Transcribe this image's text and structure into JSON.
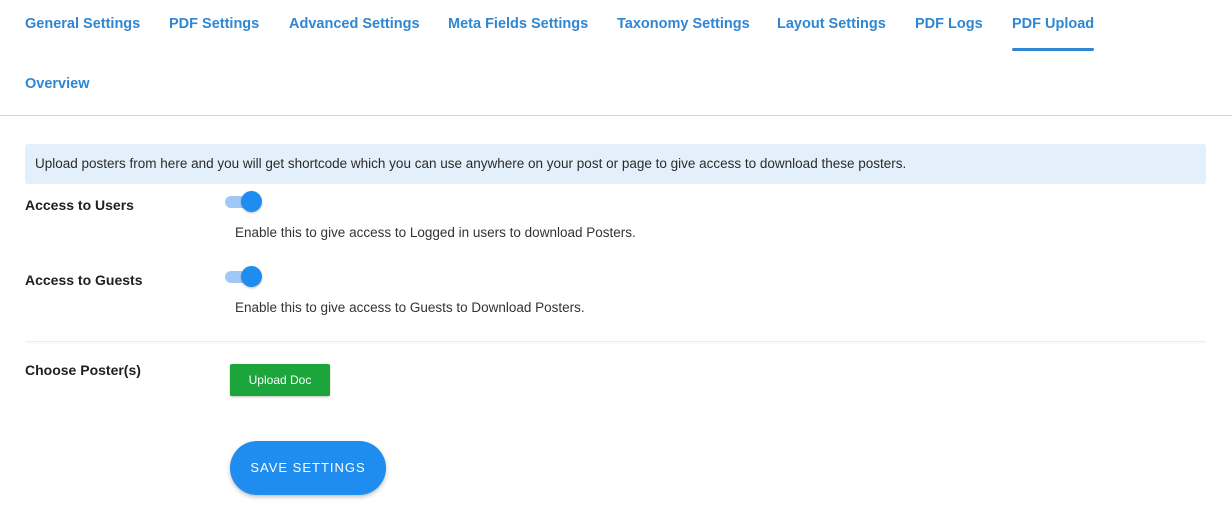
{
  "tabs": [
    {
      "label": "General Settings",
      "active": false
    },
    {
      "label": "PDF Settings",
      "active": false
    },
    {
      "label": "Advanced Settings",
      "active": false
    },
    {
      "label": "Meta Fields Settings",
      "active": false
    },
    {
      "label": "Taxonomy Settings",
      "active": false
    },
    {
      "label": "Layout Settings",
      "active": false
    },
    {
      "label": "PDF Logs",
      "active": false
    },
    {
      "label": "PDF Upload",
      "active": true
    },
    {
      "label": "Overview",
      "active": false
    }
  ],
  "notice": "Upload posters from here and you will get shortcode which you can use anywhere on your post or page to give access to download these posters.",
  "settings": {
    "users": {
      "label": "Access to Users",
      "enabled": true,
      "help": "Enable this to give access to Logged in users to download Posters."
    },
    "guests": {
      "label": "Access to Guests",
      "enabled": true,
      "help": "Enable this to give access to Guests to Download Posters."
    },
    "posters": {
      "label": "Choose Poster(s)",
      "upload_label": "Upload Doc"
    }
  },
  "save_label": "SAVE SETTINGS",
  "colors": {
    "accent": "#2f86d3",
    "toggle_on": "#1f8cf0",
    "upload_green": "#1ba53a",
    "notice_bg": "#e3f0fc"
  }
}
